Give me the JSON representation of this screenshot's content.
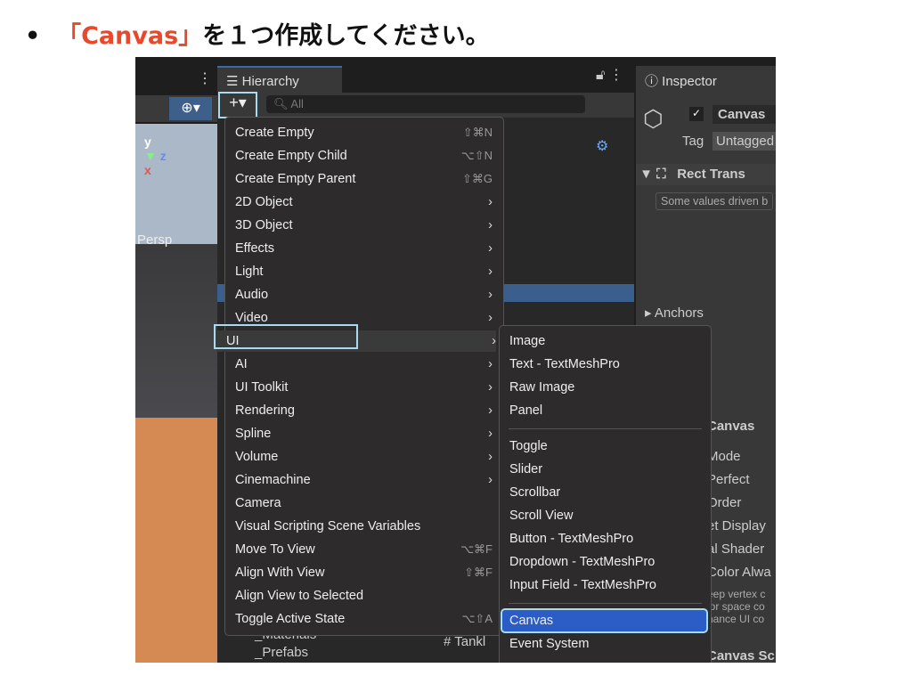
{
  "instruction": {
    "bullet": "•",
    "open": "「",
    "highlight": "Canvas",
    "close": "」",
    "rest": "を１つ作成してください。"
  },
  "hierarchy": {
    "tab": "Hierarchy",
    "search_placeholder": "All",
    "add_button": "+▾",
    "scene_label": "Persp",
    "folders": [
      "_Materials",
      "_Prefabs"
    ],
    "script_item": "Tankl"
  },
  "inspector": {
    "tab": "Inspector",
    "object_name": "Canvas",
    "tag_label": "Tag",
    "tag_value": "Untagged",
    "component": "Rect Trans",
    "note": "Some values driven b",
    "anchors": "Anchors",
    "canvas_header": "Canvas",
    "canvas_fields": [
      "Mode",
      "Perfect",
      "Order",
      "et Display",
      "al Shader",
      "Color Alwa"
    ],
    "canvas_note": [
      "eep vertex c",
      "lor space co",
      "hance UI co"
    ],
    "canvas_scaler": "Canvas Sc"
  },
  "menu": [
    {
      "label": "Create Empty",
      "shortcut": "⇧⌘N"
    },
    {
      "label": "Create Empty Child",
      "shortcut": "⌥⇧N"
    },
    {
      "label": "Create Empty Parent",
      "shortcut": "⇧⌘G"
    },
    {
      "label": "2D Object",
      "submenu": true
    },
    {
      "label": "3D Object",
      "submenu": true
    },
    {
      "label": "Effects",
      "submenu": true
    },
    {
      "label": "Light",
      "submenu": true
    },
    {
      "label": "Audio",
      "submenu": true
    },
    {
      "label": "Video",
      "submenu": true
    },
    {
      "label": "UI",
      "submenu": true
    },
    {
      "label": "AI",
      "submenu": true
    },
    {
      "label": "UI Toolkit",
      "submenu": true
    },
    {
      "label": "Rendering",
      "submenu": true
    },
    {
      "label": "Spline",
      "submenu": true
    },
    {
      "label": "Volume",
      "submenu": true
    },
    {
      "label": "Cinemachine",
      "submenu": true
    },
    {
      "label": "Camera"
    },
    {
      "label": "Visual Scripting Scene Variables"
    },
    {
      "label": "Move To View",
      "shortcut": "⌥⌘F"
    },
    {
      "label": "Align With View",
      "shortcut": "⇧⌘F"
    },
    {
      "label": "Align View to Selected"
    },
    {
      "label": "Toggle Active State",
      "shortcut": "⌥⇧A"
    }
  ],
  "submenu": [
    "Image",
    "Text - TextMeshPro",
    "Raw Image",
    "Panel",
    "Toggle",
    "Slider",
    "Scrollbar",
    "Scroll View",
    "Button - TextMeshPro",
    "Dropdown - TextMeshPro",
    "Input Field - TextMeshPro",
    "Canvas",
    "Event System"
  ],
  "colors": {
    "accent": "#2c5cc5",
    "highlight_box": "#a7dcf0",
    "title_red": "#e8482c"
  }
}
